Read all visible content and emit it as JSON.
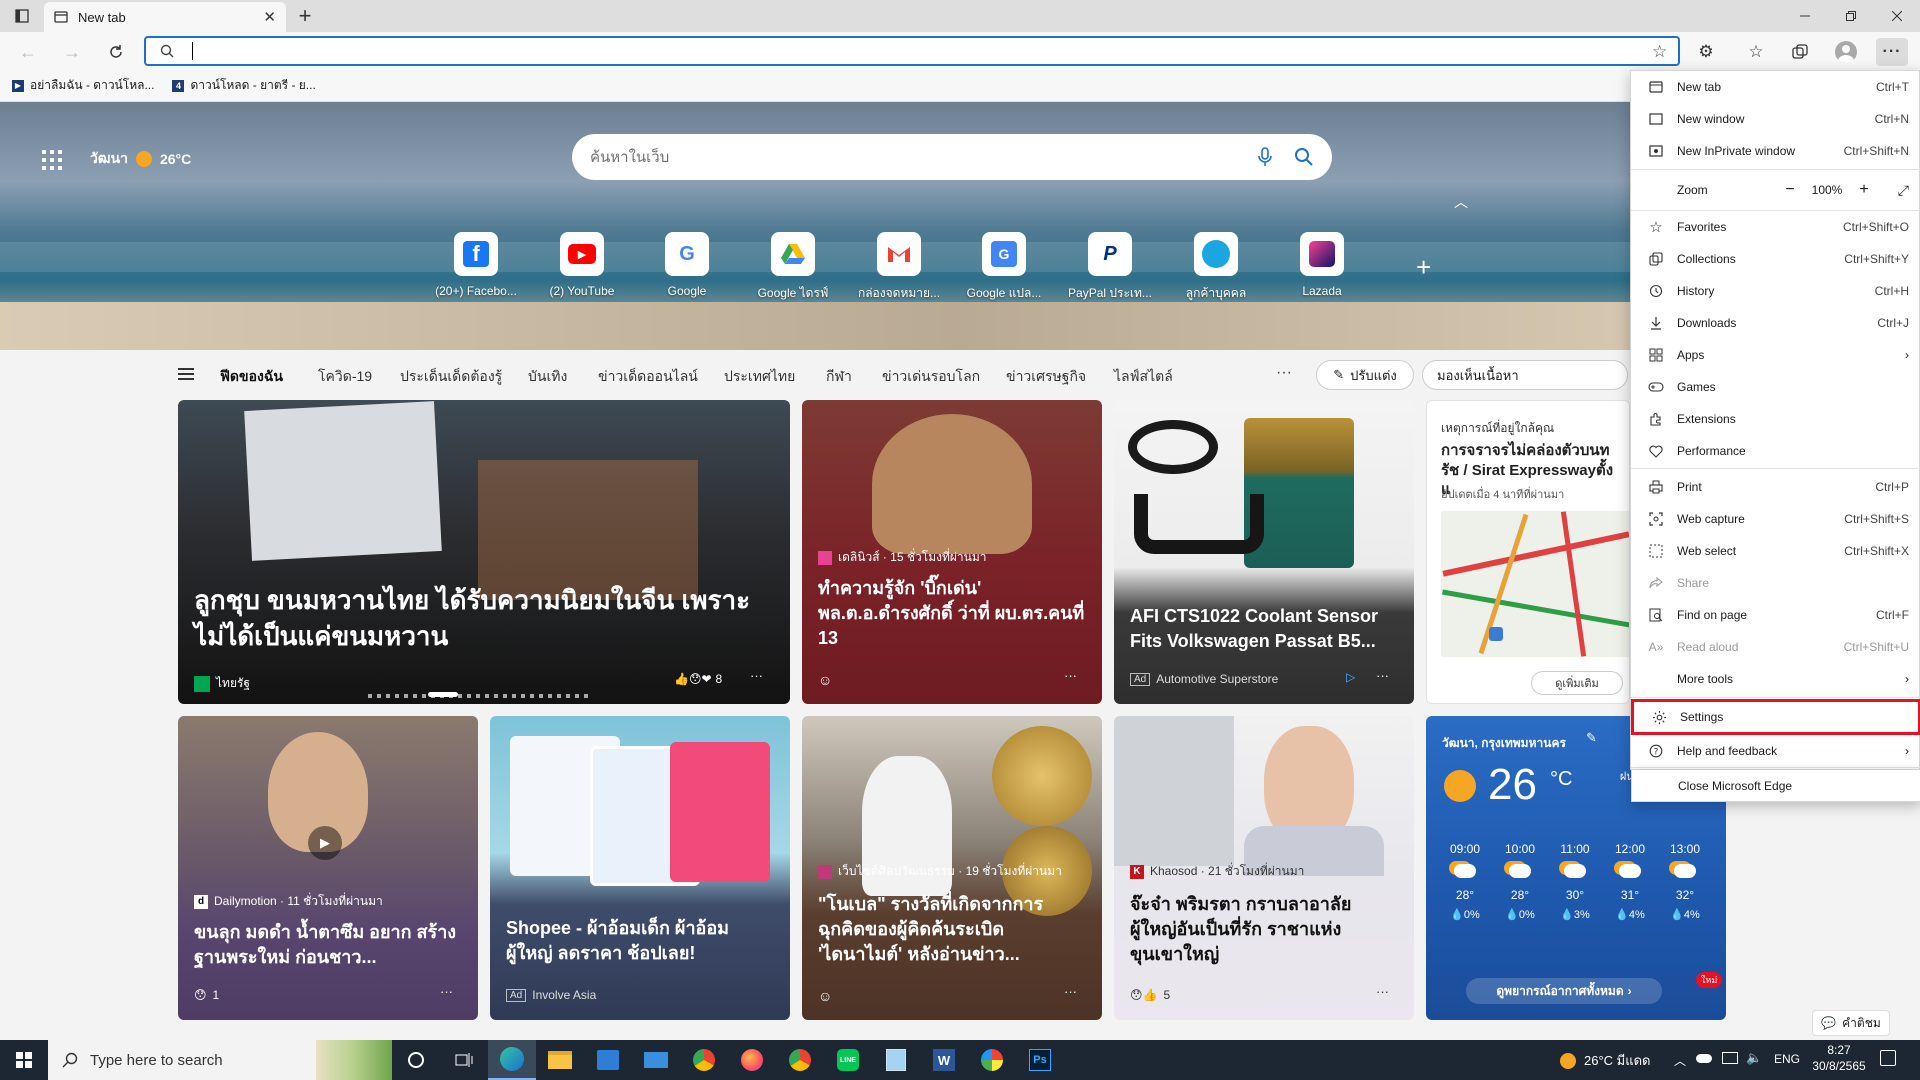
{
  "tab": {
    "title": "New tab"
  },
  "bookmarks": [
    {
      "label": "อย่าลืมฉัน - ดาวน์โหล..."
    },
    {
      "label": "ดาวน์โหลด - ยาตรี - ย..."
    }
  ],
  "header": {
    "location": "วัฒนา",
    "temperature": "26°C"
  },
  "search": {
    "placeholder": "ค้นหาในเว็บ"
  },
  "quick_links": [
    {
      "label": "(20+) Facebo...",
      "icon": "facebook-icon",
      "color": "#1877f2"
    },
    {
      "label": "(2) YouTube",
      "icon": "youtube-icon",
      "color": "#ff0000"
    },
    {
      "label": "Google",
      "icon": "google-icon",
      "color": "#4285f4"
    },
    {
      "label": "Google ไดรฟ์",
      "icon": "google-drive-icon",
      "color": "#34a853"
    },
    {
      "label": "กล่องจดหมาย...",
      "icon": "gmail-icon",
      "color": "#ea4335"
    },
    {
      "label": "Google แปล...",
      "icon": "google-translate-icon",
      "color": "#4285f4"
    },
    {
      "label": "PayPal ประเท...",
      "icon": "paypal-icon",
      "color": "#003087"
    },
    {
      "label": "ลูกค้าบุคคล",
      "icon": "bank-icon",
      "color": "#1ba5e1"
    },
    {
      "label": "Lazada",
      "icon": "lazada-icon",
      "color": "#0f146d"
    }
  ],
  "feed_nav": {
    "items": [
      "ฟีดของฉัน",
      "โควิด-19",
      "ประเด็นเด็ดต้องรู้",
      "บันเทิง",
      "ข่าวเด็ดออนไลน์",
      "ประเทศไทย",
      "กีฬา",
      "ข่าวเด่นรอบโลก",
      "ข่าวเศรษฐกิจ",
      "ไลฟ์สไตล์"
    ],
    "customize": "ปรับแต่ง",
    "visibility": "มองเห็นเนื้อหา"
  },
  "cards": {
    "hero": {
      "title": "ลูกชุบ ขนมหวานไทย ได้รับความนิยมในจีน เพราะไม่ได้เป็นแค่ขนมหวาน",
      "source": "ไทยรัฐ",
      "reactions": "8"
    },
    "c2": {
      "source": "เดลินิวส์ · 15 ชั่วโมงที่ผ่านมา",
      "title": "ทำความรู้จัก 'บิ๊กเด่น' พล.ต.อ.ดำรงศักดิ์ ว่าที่ ผบ.ตร.คนที่ 13"
    },
    "c3": {
      "title": "AFI CTS1022 Coolant Sensor Fits Volkswagen Passat B5...",
      "ad": "Ad",
      "source": "Automotive Superstore"
    },
    "c4": {
      "title": "เหตุการณ์ที่อยู่ใกล้คุณ",
      "headline": "การจราจรไม่คล่องตัวบนท รัช / Sirat Expresswayตั้งแ",
      "updated": "อัปเดตเมื่อ 4 นาทีที่ผ่านมา",
      "more": "ดูเพิ่มเติม"
    },
    "c5": {
      "source": "Dailymotion · 11 ชั่วโมงที่ผ่านมา",
      "title": "ขนลุก มดดำ น้ำตาซึม อยาก สร้างฐานพระใหม่ ก่อนชาว...",
      "reactions": "1"
    },
    "c6": {
      "title": "Shopee - ผ้าอ้อมเด็ก ผ้าอ้อม ผู้ใหญ่ ลดราคา ช้อปเลย!",
      "ad": "Ad",
      "source": "Involve Asia"
    },
    "c7": {
      "source": "เว็บไซต์ศิลปวัฒนธรรม · 19 ชั่วโมงที่ผ่านมา",
      "title": "\"โนเบล\" รางวัลที่เกิดจากการ ฉุกคิดของผู้คิดค้นระเบิด 'ไดนาไมต์' หลังอ่านข่าว..."
    },
    "c8": {
      "source": "Khaosod · 21 ชั่วโมงที่ผ่านมา",
      "title": "จ๊ะจ๋า พริมรตา กราบลาอาลัย ผู้ใหญ่อันเป็นที่รัก ราชาแห่ง ขุนเขาใหญ่",
      "reactions": "5"
    },
    "weather": {
      "location": "วัฒนา, กรุงเทพมหานคร",
      "temp": "26",
      "unit": "°C",
      "note": "ฝนตก ในอีก 2 วัน",
      "forecast": [
        {
          "time": "09:00",
          "temp": "28°",
          "rain": "0%"
        },
        {
          "time": "10:00",
          "temp": "28°",
          "rain": "0%"
        },
        {
          "time": "11:00",
          "temp": "30°",
          "rain": "3%"
        },
        {
          "time": "12:00",
          "temp": "31°",
          "rain": "4%"
        },
        {
          "time": "13:00",
          "temp": "32°",
          "rain": "4%"
        }
      ],
      "link": "ดูพยากรณ์อากาศทั้งหมด",
      "badge": "ใหม่"
    }
  },
  "feedback": "คำติชม",
  "menu": {
    "items": [
      {
        "label": "New tab",
        "shortcut": "Ctrl+T",
        "icon": "new-tab-icon"
      },
      {
        "label": "New window",
        "shortcut": "Ctrl+N",
        "icon": "new-window-icon"
      },
      {
        "label": "New InPrivate window",
        "shortcut": "Ctrl+Shift+N",
        "icon": "inprivate-icon"
      },
      {
        "label": "Favorites",
        "shortcut": "Ctrl+Shift+O",
        "icon": "favorites-icon"
      },
      {
        "label": "Collections",
        "shortcut": "Ctrl+Shift+Y",
        "icon": "collections-icon"
      },
      {
        "label": "History",
        "shortcut": "Ctrl+H",
        "icon": "history-icon"
      },
      {
        "label": "Downloads",
        "shortcut": "Ctrl+J",
        "icon": "downloads-icon"
      },
      {
        "label": "Apps",
        "shortcut": "",
        "icon": "apps-icon"
      },
      {
        "label": "Games",
        "shortcut": "",
        "icon": "games-icon"
      },
      {
        "label": "Extensions",
        "shortcut": "",
        "icon": "extensions-icon"
      },
      {
        "label": "Performance",
        "shortcut": "",
        "icon": "performance-icon"
      },
      {
        "label": "Print",
        "shortcut": "Ctrl+P",
        "icon": "print-icon"
      },
      {
        "label": "Web capture",
        "shortcut": "Ctrl+Shift+S",
        "icon": "web-capture-icon"
      },
      {
        "label": "Web select",
        "shortcut": "Ctrl+Shift+X",
        "icon": "web-select-icon"
      },
      {
        "label": "Share",
        "shortcut": "",
        "icon": "share-icon"
      },
      {
        "label": "Find on page",
        "shortcut": "Ctrl+F",
        "icon": "find-icon"
      },
      {
        "label": "Read aloud",
        "shortcut": "Ctrl+Shift+U",
        "icon": "read-aloud-icon"
      },
      {
        "label": "More tools",
        "shortcut": "",
        "icon": "more-tools-icon"
      },
      {
        "label": "Settings",
        "shortcut": "",
        "icon": "settings-icon"
      },
      {
        "label": "Help and feedback",
        "shortcut": "",
        "icon": "help-icon"
      },
      {
        "label": "Close Microsoft Edge",
        "shortcut": "",
        "icon": "close-edge-icon"
      }
    ],
    "zoom": {
      "label": "Zoom",
      "value": "100%"
    },
    "highlight_color": "#e81123"
  },
  "taskbar": {
    "search_placeholder": "Type here to search",
    "weather": "26°C มีแดด",
    "lang": "ENG",
    "time": "8:27",
    "date": "30/8/2565"
  }
}
